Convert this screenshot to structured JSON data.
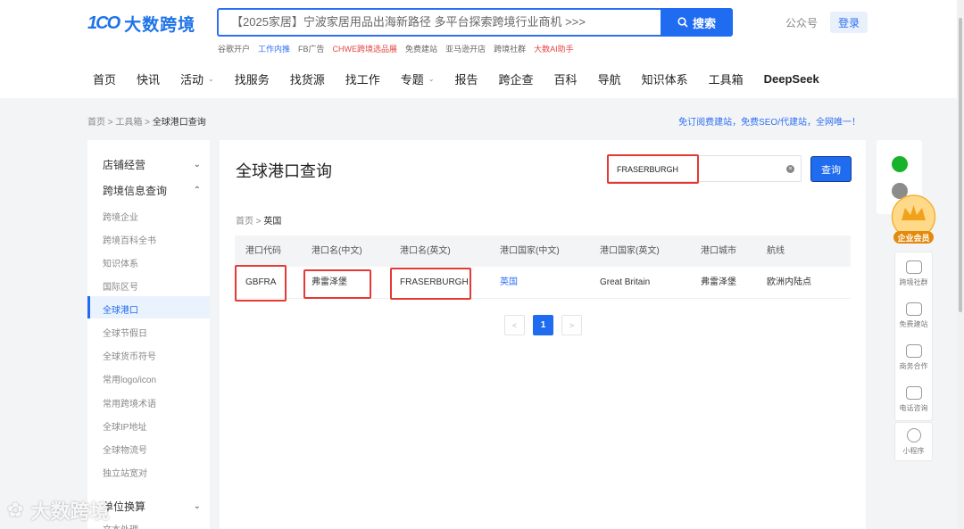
{
  "header": {
    "logo_mark": "1CO",
    "logo_text": "大数跨境",
    "search_text": "【2025家居】宁波家居用品出海新路径 多平台探索跨境行业商机 >>>",
    "search_button": "搜索",
    "hotwords": [
      "谷歌开户",
      "工作内推",
      "FB广告",
      "CHWE跨境选品展",
      "免费建站",
      "亚马逊开店",
      "跨境社群",
      "大数AI助手"
    ],
    "gzh": "公众号",
    "login": "登录",
    "nav": [
      "首页",
      "快讯",
      "活动",
      "找服务",
      "找货源",
      "找工作",
      "专题",
      "报告",
      "跨企查",
      "百科",
      "导航",
      "知识体系",
      "工具箱",
      "DeepSeek"
    ]
  },
  "breadcrumb": {
    "items": [
      "首页 >",
      "工具箱 >"
    ],
    "current": "全球港口查询",
    "promo": "免订阅费建站，免费SEO/代建站，全网唯一！"
  },
  "sidebar": {
    "groups": [
      "店铺经营",
      "跨境信息查询",
      "单位换算"
    ],
    "items": [
      "跨境企业",
      "跨境百科全书",
      "知识体系",
      "国际区号",
      "全球港口",
      "全球节假日",
      "全球货币符号",
      "常用logo/icon",
      "常用跨境术语",
      "全球IP地址",
      "全球物流号",
      "独立站宽对",
      "文本处理"
    ]
  },
  "main": {
    "title": "全球港口查询",
    "query_value": "FRASERBURGH",
    "query_button": "查询",
    "sub_crumb_home": "首页",
    "sub_crumb_current": "英国",
    "columns": [
      "港口代码",
      "港口名(中文)",
      "港口名(英文)",
      "港口国家(中文)",
      "港口国家(英文)",
      "港口城市",
      "航线"
    ],
    "row": [
      "GBFRA",
      "弗雷泽堡",
      "FRASERBURGH",
      "英国",
      "Great Britain",
      "弗雷泽堡",
      "欧洲内陆点"
    ],
    "pager": [
      "<",
      "1",
      ">"
    ]
  },
  "float": {
    "vip": "企业会员",
    "items": [
      "跨境社群",
      "免费建站",
      "商务合作",
      "电话咨询"
    ],
    "mini": "小程序"
  },
  "watermark": "大数跨境"
}
